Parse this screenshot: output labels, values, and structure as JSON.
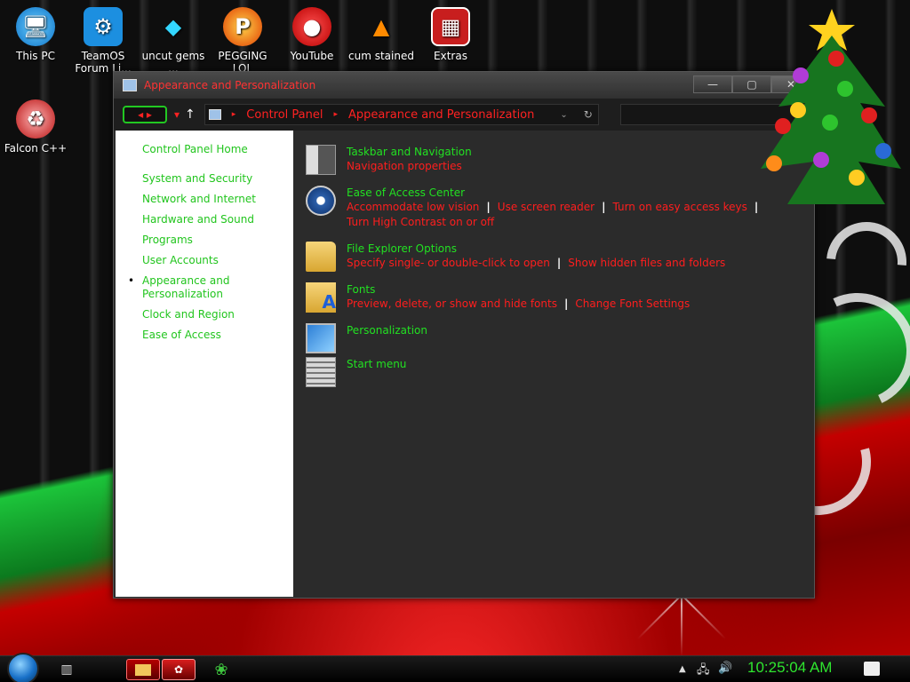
{
  "desktop": {
    "icons": [
      {
        "label": "This PC",
        "icon": "computer-icon"
      },
      {
        "label": "TeamOS Forum Li...",
        "icon": "gear-icon"
      },
      {
        "label": "uncut gems ...",
        "icon": "diamond-icon"
      },
      {
        "label": "PEGGING LOL",
        "icon": "game-icon"
      },
      {
        "label": "YouTube",
        "icon": "angry-bird-icon"
      },
      {
        "label": "cum stained",
        "icon": "traffic-cone-icon"
      },
      {
        "label": "Extras",
        "icon": "box-icon"
      },
      {
        "label": "Falcon C++",
        "icon": "recycle-icon"
      }
    ]
  },
  "window": {
    "title": "Appearance and Personalization",
    "nav": {
      "back_forward": "◂ ▸",
      "recent": "▾",
      "up": "↑"
    },
    "address": {
      "crumbs": [
        "Control Panel",
        "Appearance and Personalization"
      ],
      "separator": "▸"
    },
    "sidebar": {
      "home": "Control Panel Home",
      "items": [
        "System and Security",
        "Network and Internet",
        "Hardware and Sound",
        "Programs",
        "User Accounts",
        "Appearance and Personalization",
        "Clock and Region",
        "Ease of Access"
      ],
      "current_index": 5
    },
    "categories": [
      {
        "title": "Taskbar and Navigation",
        "links": [
          "Navigation properties"
        ],
        "icon": "taskbar-icon"
      },
      {
        "title": "Ease of Access Center",
        "links": [
          "Accommodate low vision",
          "Use screen reader",
          "Turn on easy access keys",
          "Turn High Contrast on or off"
        ],
        "icon": "ease-of-access-icon"
      },
      {
        "title": "File Explorer Options",
        "links": [
          "Specify single- or double-click to open",
          "Show hidden files and folders"
        ],
        "icon": "folder-options-icon"
      },
      {
        "title": "Fonts",
        "links": [
          "Preview, delete, or show and hide fonts",
          "Change Font Settings"
        ],
        "icon": "fonts-icon"
      },
      {
        "title": "Personalization",
        "links": [],
        "icon": "personalization-icon"
      },
      {
        "title": "Start menu",
        "links": [],
        "icon": "start-menu-icon"
      }
    ]
  },
  "taskbar": {
    "clock": "10:25:04 AM"
  },
  "colors": {
    "link_green": "#22e022",
    "link_red": "#ff1e1e",
    "window_bg": "#2b2b2b"
  }
}
